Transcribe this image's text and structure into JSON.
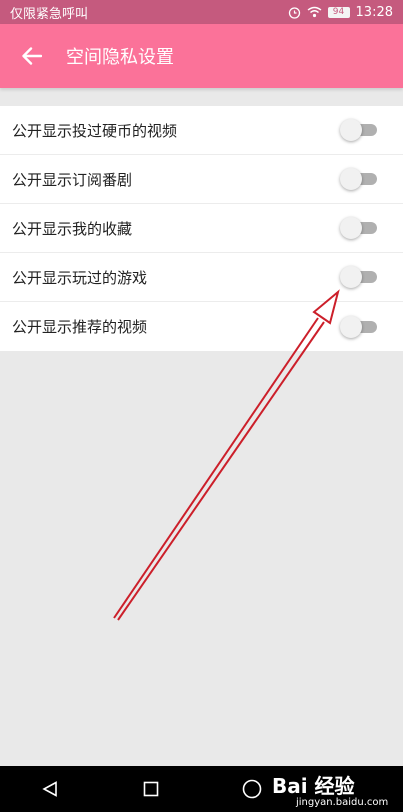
{
  "status_bar": {
    "left_text": "仅限紧急呼叫",
    "battery": "94",
    "time": "13:28",
    "icons": [
      "alarm-icon",
      "wifi-icon",
      "battery-icon"
    ]
  },
  "app_bar": {
    "title": "空间隐私设置",
    "back_icon": "arrow-left-icon",
    "color": "#fb7299"
  },
  "settings": [
    {
      "label": "公开显示投过硬币的视频",
      "enabled": false
    },
    {
      "label": "公开显示订阅番剧",
      "enabled": false
    },
    {
      "label": "公开显示我的收藏",
      "enabled": false
    },
    {
      "label": "公开显示玩过的游戏",
      "enabled": false
    },
    {
      "label": "公开显示推荐的视频",
      "enabled": false
    }
  ],
  "nav_bar": {
    "icons": [
      "back-triangle-icon",
      "home-circle-icon",
      "recents-square-icon"
    ]
  },
  "watermark": {
    "main": "Bai 经验",
    "sub": "jingyan.baidu.com"
  },
  "annotation": {
    "color": "#cc1f2a"
  }
}
